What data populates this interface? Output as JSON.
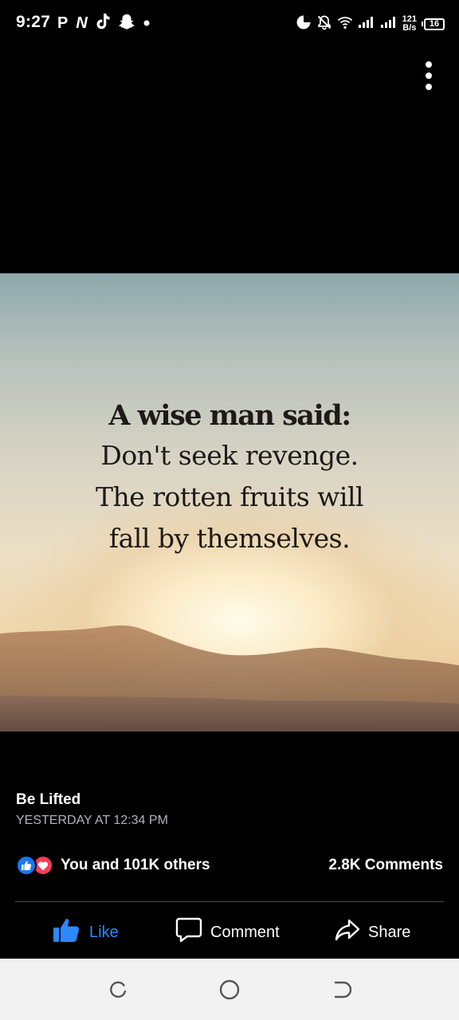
{
  "status_bar": {
    "time": "9:27",
    "left_icons": [
      "p-app-icon",
      "n-app-icon",
      "tiktok-icon",
      "snapchat-icon",
      "dot-icon"
    ],
    "left_glyphs": [
      "P",
      "N"
    ],
    "net_speed_value": "121",
    "net_speed_unit": "B/s",
    "battery_level": "16"
  },
  "post": {
    "image": {
      "quote_heading": "A wise man said:",
      "quote_lines": [
        "Don't seek revenge.",
        "The rotten fruits will",
        "fall by themselves."
      ]
    },
    "author": "Be Lifted",
    "timestamp": "YESTERDAY AT 12:34 PM",
    "reactions_text": "You and 101K others",
    "comments_count": "2.8K Comments"
  },
  "actions": {
    "like_label": "Like",
    "comment_label": "Comment",
    "share_label": "Share"
  },
  "colors": {
    "like_active": "#2d88ff",
    "reaction_like": "#1877f2",
    "reaction_love": "#f33e58",
    "nav_bar_bg": "#f2f2f2"
  }
}
